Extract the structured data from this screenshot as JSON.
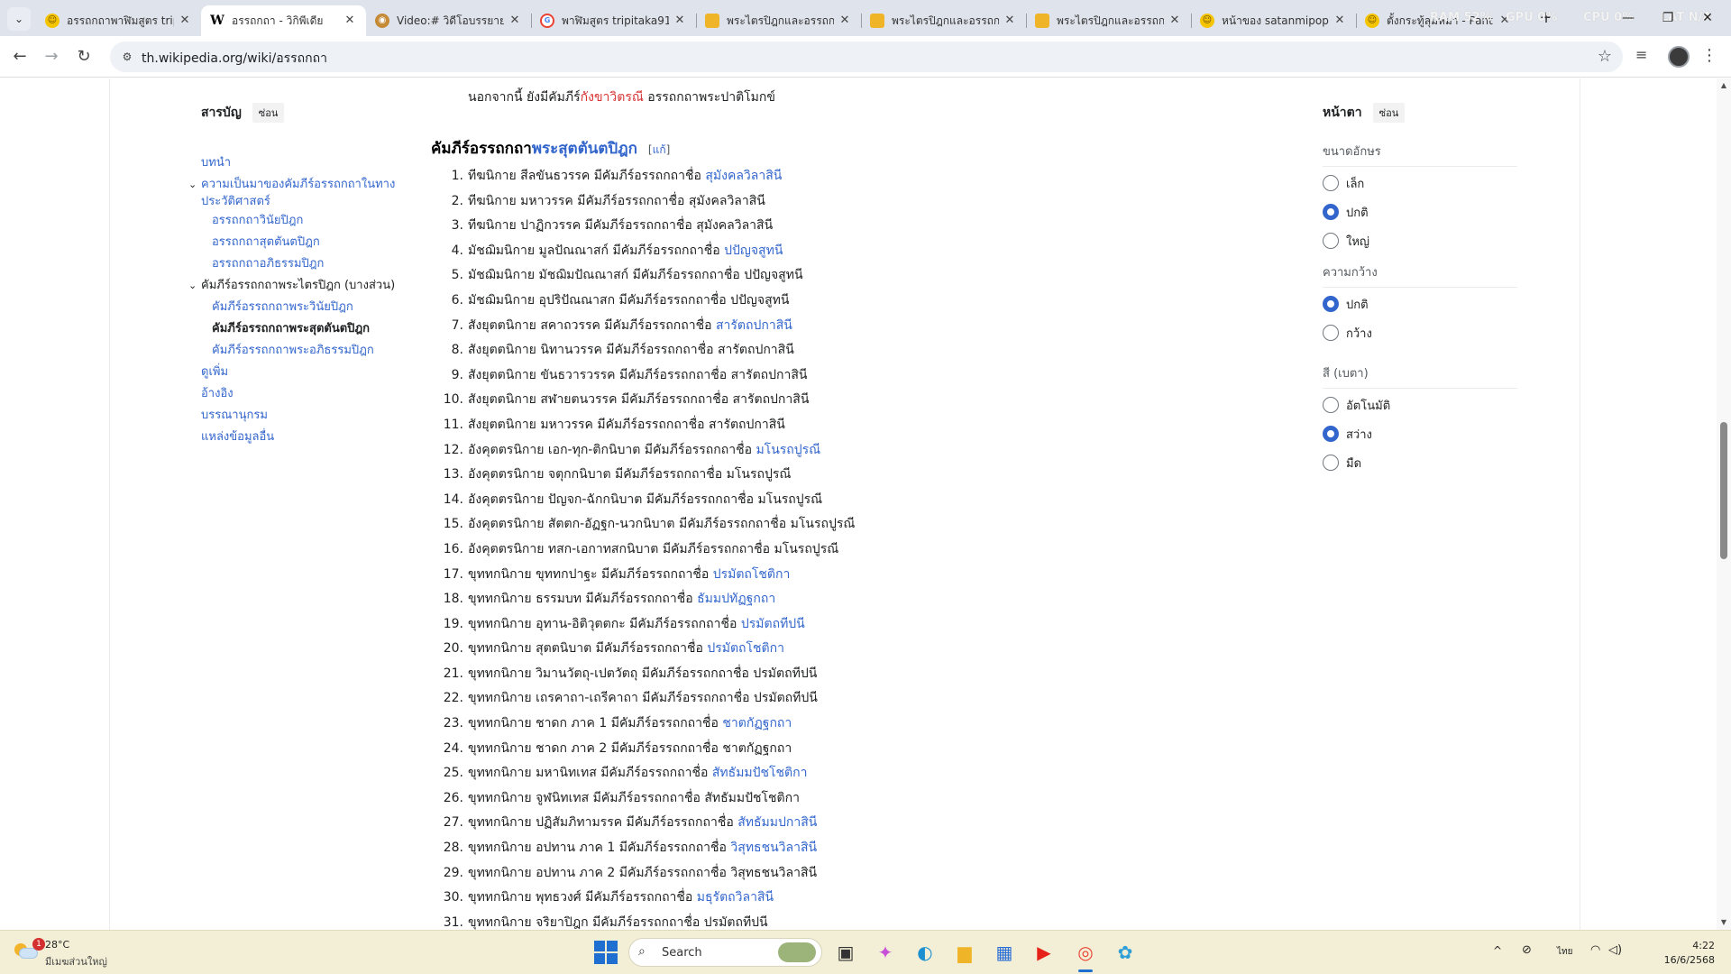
{
  "browser": {
    "tabs": [
      {
        "title": "อรรถกถาพาฬิมสูตร tripi",
        "fav": "emoji",
        "glyph": "☺",
        "active": false
      },
      {
        "title": "อรรถกถา - วิกิพีเดีย",
        "fav": "w",
        "glyph": "W",
        "active": true
      },
      {
        "title": "Video:# วิดีโอบรรยายฯ",
        "fav": "ring",
        "glyph": "◉",
        "active": false
      },
      {
        "title": "พาฬิมสูตร tripitaka91 -",
        "fav": "g",
        "glyph": "G",
        "active": false
      },
      {
        "title": "พระไตรปิฎกและอรรถกถ",
        "fav": "folder",
        "glyph": "▬",
        "active": false
      },
      {
        "title": "พระไตรปิฎกและอรรถกถ",
        "fav": "folder",
        "glyph": "▬",
        "active": false
      },
      {
        "title": "พระไตรปิฎกและอรรถกถ",
        "fav": "folder",
        "glyph": "▬",
        "active": false
      },
      {
        "title": "หน้าของ satanmipop -",
        "fav": "emoji",
        "glyph": "☺",
        "active": false
      },
      {
        "title": "ตั้งกระทู้ลุมหมา - Pantip",
        "fav": "emoji",
        "glyph": "☺",
        "active": false
      }
    ],
    "tab_close_glyph": "✕",
    "new_tab_glyph": "+",
    "menu_glyph": "⌄",
    "sysmon": {
      "ram": "RAM 52%",
      "gpu": "GPU 0%",
      "cpu": "CPU 0%",
      "net": "LAT N/A"
    },
    "window": {
      "minimize": "—",
      "restore": "❐",
      "close": "✕"
    },
    "nav": {
      "back": "←",
      "forward": "→",
      "reload": "↻"
    },
    "url": "th.wikipedia.org/wiki/อรรถกถา",
    "star_glyph": "☆",
    "media_glyph": "≡",
    "menu_dots": "⋮",
    "site_info_glyph": "⚙"
  },
  "toc": {
    "title": "สารบัญ",
    "hide_label": "ซ่อน",
    "items": [
      {
        "label": "บทนำ",
        "level": 1,
        "state": "link"
      },
      {
        "label": "ความเป็นมาของคัมภีร์อรรถกถาในทางประวัติศาสตร์",
        "level": 1,
        "state": "link",
        "toggle": "⌄"
      },
      {
        "label": "อรรถกถาวินัยปิฎก",
        "level": 2,
        "state": "link"
      },
      {
        "label": "อรรถกถาสุตตันตปิฎก",
        "level": 2,
        "state": "link"
      },
      {
        "label": "อรรถกถาอภิธรรมปิฎก",
        "level": 2,
        "state": "link"
      },
      {
        "label": "คัมภีร์อรรถกถาพระไตรปิฎก (บางส่วน)",
        "level": 1,
        "state": "plain",
        "toggle": "⌄"
      },
      {
        "label": "คัมภีร์อรรถกถาพระวินัยปิฎก",
        "level": 2,
        "state": "link"
      },
      {
        "label": "คัมภีร์อรรถกถาพระสุตตันตปิฎก",
        "level": 2,
        "state": "current"
      },
      {
        "label": "คัมภีร์อรรถกถาพระอภิธรรมปิฎก",
        "level": 2,
        "state": "link"
      },
      {
        "label": "ดูเพิ่ม",
        "level": 1,
        "state": "link"
      },
      {
        "label": "อ้างอิง",
        "level": 1,
        "state": "link"
      },
      {
        "label": "บรรณานุกรม",
        "level": 1,
        "state": "link"
      },
      {
        "label": "แหล่งข้อมูลอื่น",
        "level": 1,
        "state": "link"
      }
    ]
  },
  "article": {
    "intro": {
      "pre": "นอกจากนี้ ยังมีคัมภีร์",
      "link": "กังขาวิตรณี",
      "post": " อรรถกถาพระปาติโมกข์"
    },
    "heading": {
      "pre": "คัมภีร์อรรถกถา",
      "link": "พระสุตตันตปิฎก",
      "edit_open": "[",
      "edit": "แก้",
      "edit_close": "]"
    },
    "list": [
      {
        "n": "1.",
        "text": "ทีฆนิกาย สีลขันธวรรค มีคัมภีร์อรรถกถาชื่อ ",
        "link": "สุมังคลวิลาสินี"
      },
      {
        "n": "2.",
        "text": "ทีฆนิกาย มหาวรรค มีคัมภีร์อรรถกถาชื่อ สุมังคลวิลาสินี",
        "link": ""
      },
      {
        "n": "3.",
        "text": "ทีฆนิกาย ปาฏิกวรรค มีคัมภีร์อรรถกถาชื่อ สุมังคลวิลาสินี",
        "link": ""
      },
      {
        "n": "4.",
        "text": "มัชฌิมนิกาย มูลปัณณาสก์ มีคัมภีร์อรรถกถาชื่อ ",
        "link": "ปปัญจสูทนี"
      },
      {
        "n": "5.",
        "text": "มัชฌิมนิกาย มัชฌิมปัณณาสก์ มีคัมภีร์อรรถกถาชื่อ ปปัญจสูทนี",
        "link": ""
      },
      {
        "n": "6.",
        "text": "มัชฌิมนิกาย อุปริปัณณาสก มีคัมภีร์อรรถกถาชื่อ ปปัญจสูทนี",
        "link": ""
      },
      {
        "n": "7.",
        "text": "สังยุตตนิกาย สคาถวรรค มีคัมภีร์อรรถกถาชื่อ ",
        "link": "สารัตถปกาสินี"
      },
      {
        "n": "8.",
        "text": "สังยุตตนิกาย นิทานวรรค มีคัมภีร์อรรถกถาชื่อ สารัตถปกาสินี",
        "link": ""
      },
      {
        "n": "9.",
        "text": "สังยุตตนิกาย ขันธวารวรรค มีคัมภีร์อรรถกถาชื่อ สารัตถปกาสินี",
        "link": ""
      },
      {
        "n": "10.",
        "text": "สังยุตตนิกาย สฬายตนวรรค มีคัมภีร์อรรถกถาชื่อ สารัตถปกาสินี",
        "link": ""
      },
      {
        "n": "11.",
        "text": "สังยุตตนิกาย มหาวรรค มีคัมภีร์อรรถกถาชื่อ สารัตถปกาสินี",
        "link": ""
      },
      {
        "n": "12.",
        "text": "อังคุตตรนิกาย เอก-ทุก-ติกนิบาต มีคัมภีร์อรรถกถาชื่อ ",
        "link": "มโนรถปูรณี"
      },
      {
        "n": "13.",
        "text": "อังคุตตรนิกาย จตุกกนิบาต มีคัมภีร์อรรถกถาชื่อ มโนรถปูรณี",
        "link": ""
      },
      {
        "n": "14.",
        "text": "อังคุตตรนิกาย ปัญจก-ฉักกนิบาต มีคัมภีร์อรรถกถาชื่อ มโนรถปูรณี",
        "link": ""
      },
      {
        "n": "15.",
        "text": "อังคุตตรนิกาย สัตตก-อัฏฐก-นวกนิบาต มีคัมภีร์อรรถกถาชื่อ มโนรถปูรณี",
        "link": ""
      },
      {
        "n": "16.",
        "text": "อังคุตตรนิกาย ทสก-เอกาทสกนิบาต มีคัมภีร์อรรถกถาชื่อ มโนรถปูรณี",
        "link": ""
      },
      {
        "n": "17.",
        "text": "ขุททกนิกาย ขุททกปาฐะ มีคัมภีร์อรรถกถาชื่อ ",
        "link": "ปรมัตถโชติกา"
      },
      {
        "n": "18.",
        "text": "ขุททกนิกาย ธรรมบท มีคัมภีร์อรรถกถาชื่อ ",
        "link": "ธัมมปทัฏฐกถา"
      },
      {
        "n": "19.",
        "text": "ขุททกนิกาย อุทาน-อิติวุตตกะ มีคัมภีร์อรรถกถาชื่อ ",
        "link": "ปรมัตถทีปนี"
      },
      {
        "n": "20.",
        "text": "ขุททกนิกาย สุตตนิบาต มีคัมภีร์อรรถกถาชื่อ ",
        "link": "ปรมัตถโชติกา"
      },
      {
        "n": "21.",
        "text": "ขุททกนิกาย วิมานวัตถุ-เปตวัตถุ มีคัมภีร์อรรถกถาชื่อ ปรมัตถทีปนี",
        "link": ""
      },
      {
        "n": "22.",
        "text": "ขุททกนิกาย เถรคาถา-เถรีคาถา มีคัมภีร์อรรถกถาชื่อ ปรมัตถทีปนี",
        "link": ""
      },
      {
        "n": "23.",
        "text": "ขุททกนิกาย ชาดก ภาค 1 มีคัมภีร์อรรถกถาชื่อ ",
        "link": "ชาตกัฏฐกถา"
      },
      {
        "n": "24.",
        "text": "ขุททกนิกาย ชาดก ภาค 2 มีคัมภีร์อรรถกถาชื่อ ชาตกัฏฐกถา",
        "link": ""
      },
      {
        "n": "25.",
        "text": "ขุททกนิกาย มหานิทเทส มีคัมภีร์อรรถกถาชื่อ ",
        "link": "สัทธัมมปัชโชติกา"
      },
      {
        "n": "26.",
        "text": "ขุททกนิกาย จูฬนิทเทส มีคัมภีร์อรรถกถาชื่อ สัทธัมมปัชโชติกา",
        "link": ""
      },
      {
        "n": "27.",
        "text": "ขุททกนิกาย ปฏิสัมภิทามรรค มีคัมภีร์อรรถกถาชื่อ ",
        "link": "สัทธัมมปกาสินี"
      },
      {
        "n": "28.",
        "text": "ขุททกนิกาย อปทาน ภาค 1 มีคัมภีร์อรรถกถาชื่อ ",
        "link": "วิสุทธชนวิลาสินี"
      },
      {
        "n": "29.",
        "text": "ขุททกนิกาย อปทาน ภาค 2 มีคัมภีร์อรรถกถาชื่อ วิสุทธชนวิลาสินี",
        "link": ""
      },
      {
        "n": "30.",
        "text": "ขุททกนิกาย พุทธวงศ์ มีคัมภีร์อรรถกถาชื่อ ",
        "link": "มธุรัตถวิลาสินี"
      },
      {
        "n": "31.",
        "text": "ขุททกนิกาย จริยาปิฎก มีคัมภีร์อรรถกถาชื่อ ปรมัตถทีปนี",
        "link": ""
      }
    ]
  },
  "appearance": {
    "title": "หน้าตา",
    "hide_label": "ซ่อน",
    "groups": [
      {
        "label": "ขนาดอักษร",
        "options": [
          {
            "label": "เล็ก",
            "checked": false
          },
          {
            "label": "ปกติ",
            "checked": true
          },
          {
            "label": "ใหญ่",
            "checked": false
          }
        ]
      },
      {
        "label": "ความกว้าง",
        "options": [
          {
            "label": "ปกติ",
            "checked": true
          },
          {
            "label": "กว้าง",
            "checked": false
          }
        ]
      },
      {
        "label": "สี (เบตา)",
        "options": [
          {
            "label": "อัตโนมัติ",
            "checked": false
          },
          {
            "label": "สว่าง",
            "checked": true
          },
          {
            "label": "มืด",
            "checked": false
          }
        ]
      }
    ]
  },
  "scrollbar": {
    "up": "▲",
    "down": "▼",
    "position": 0.48
  },
  "taskbar": {
    "weather_temp": "28°C",
    "weather_desc": "มีเมฆส่วนใหญ่",
    "weather_badge": "1",
    "search_label": "Search",
    "search_glyph": "⌕",
    "apps": [
      {
        "name": "task-view-icon",
        "glyph": "▣",
        "color": "#333333"
      },
      {
        "name": "copilot-icon",
        "glyph": "✦",
        "color": "#c84fd8"
      },
      {
        "name": "edge-icon",
        "glyph": "◐",
        "color": "#1b8fd0"
      },
      {
        "name": "file-explorer-icon",
        "glyph": "▆",
        "color": "#f0b429"
      },
      {
        "name": "microsoft-store-icon",
        "glyph": "▦",
        "color": "#2b6fd6"
      },
      {
        "name": "youtube-icon",
        "glyph": "▶",
        "color": "#e62117"
      },
      {
        "name": "chrome-icon",
        "glyph": "◎",
        "color": "#ea4335"
      },
      {
        "name": "app-icon",
        "glyph": "✿",
        "color": "#2f9fd6"
      }
    ],
    "tray_chevron": "^",
    "tray_vpn": "⊘",
    "lang": "ไทย",
    "wifi": "◠",
    "volume": "◁)",
    "time": "4:22",
    "date": "16/6/2568"
  }
}
